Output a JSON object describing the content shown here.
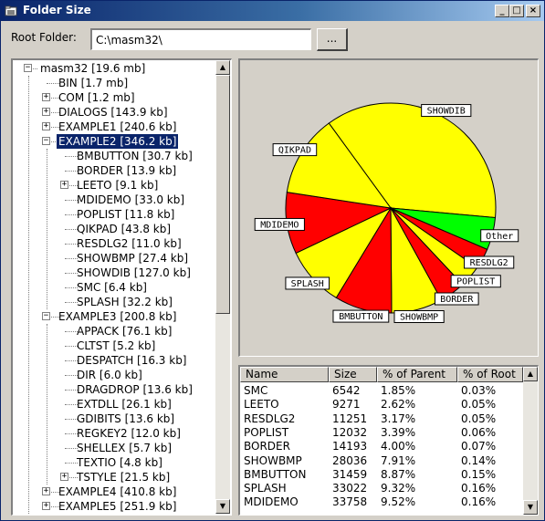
{
  "window": {
    "title": "Folder Size",
    "icon": "folder-icon"
  },
  "title_buttons": {
    "minimize": "_",
    "maximize": "□",
    "close": "×"
  },
  "root": {
    "label": "Root Folder:",
    "value": "C:\\masm32\\",
    "browse_label": "..."
  },
  "tree": {
    "items": [
      {
        "label": "masm32 [19.6 mb]",
        "level": 0,
        "expander": "−",
        "selected": false
      },
      {
        "label": "BIN [1.7 mb]",
        "level": 1,
        "expander": "",
        "selected": false
      },
      {
        "label": "COM [1.2 mb]",
        "level": 1,
        "expander": "+",
        "selected": false
      },
      {
        "label": "DIALOGS [143.9 kb]",
        "level": 1,
        "expander": "+",
        "selected": false
      },
      {
        "label": "EXAMPLE1 [240.6 kb]",
        "level": 1,
        "expander": "+",
        "selected": false
      },
      {
        "label": "EXAMPLE2 [346.2 kb]",
        "level": 1,
        "expander": "−",
        "selected": true
      },
      {
        "label": "BMBUTTON [30.7 kb]",
        "level": 2,
        "expander": "",
        "selected": false
      },
      {
        "label": "BORDER [13.9 kb]",
        "level": 2,
        "expander": "",
        "selected": false
      },
      {
        "label": "LEETO [9.1 kb]",
        "level": 2,
        "expander": "+",
        "selected": false
      },
      {
        "label": "MDIDEMO [33.0 kb]",
        "level": 2,
        "expander": "",
        "selected": false
      },
      {
        "label": "POPLIST [11.8 kb]",
        "level": 2,
        "expander": "",
        "selected": false
      },
      {
        "label": "QIKPAD [43.8 kb]",
        "level": 2,
        "expander": "",
        "selected": false
      },
      {
        "label": "RESDLG2 [11.0 kb]",
        "level": 2,
        "expander": "",
        "selected": false
      },
      {
        "label": "SHOWBMP [27.4 kb]",
        "level": 2,
        "expander": "",
        "selected": false
      },
      {
        "label": "SHOWDIB [127.0 kb]",
        "level": 2,
        "expander": "",
        "selected": false
      },
      {
        "label": "SMC [6.4 kb]",
        "level": 2,
        "expander": "",
        "selected": false
      },
      {
        "label": "SPLASH [32.2 kb]",
        "level": 2,
        "expander": "",
        "selected": false
      },
      {
        "label": "EXAMPLE3 [200.8 kb]",
        "level": 1,
        "expander": "−",
        "selected": false
      },
      {
        "label": "APPACK [76.1 kb]",
        "level": 2,
        "expander": "",
        "selected": false
      },
      {
        "label": "CLTST [5.2 kb]",
        "level": 2,
        "expander": "",
        "selected": false
      },
      {
        "label": "DESPATCH [16.3 kb]",
        "level": 2,
        "expander": "",
        "selected": false
      },
      {
        "label": "DIR [6.0 kb]",
        "level": 2,
        "expander": "",
        "selected": false
      },
      {
        "label": "DRAGDROP [13.6 kb]",
        "level": 2,
        "expander": "",
        "selected": false
      },
      {
        "label": "EXTDLL [26.1 kb]",
        "level": 2,
        "expander": "",
        "selected": false
      },
      {
        "label": "GDIBITS [13.6 kb]",
        "level": 2,
        "expander": "",
        "selected": false
      },
      {
        "label": "REGKEY2 [12.0 kb]",
        "level": 2,
        "expander": "",
        "selected": false
      },
      {
        "label": "SHELLEX [5.7 kb]",
        "level": 2,
        "expander": "",
        "selected": false
      },
      {
        "label": "TEXTIO [4.8 kb]",
        "level": 2,
        "expander": "",
        "selected": false
      },
      {
        "label": "TSTYLE [21.5 kb]",
        "level": 2,
        "expander": "+",
        "selected": false
      },
      {
        "label": "EXAMPLE4 [410.8 kb]",
        "level": 1,
        "expander": "+",
        "selected": false
      },
      {
        "label": "EXAMPLE5 [251.9 kb]",
        "level": 1,
        "expander": "+",
        "selected": false
      }
    ]
  },
  "pie": {
    "colors": {
      "yellow": "#ffff00",
      "red": "#ff0000",
      "green": "#00ff00"
    },
    "slices": [
      {
        "label": "SHOWDIB",
        "value": 127.0,
        "color": "#ffff00"
      },
      {
        "label": "Other",
        "value": 17.4,
        "color": "#00ff00"
      },
      {
        "label": "RESDLG2",
        "value": 11.0,
        "color": "#ff0000"
      },
      {
        "label": "POPLIST",
        "value": 11.8,
        "color": "#ffff00"
      },
      {
        "label": "BORDER",
        "value": 13.9,
        "color": "#ff0000"
      },
      {
        "label": "SHOWBMP",
        "value": 27.4,
        "color": "#ffff00"
      },
      {
        "label": "BMBUTTON",
        "value": 30.7,
        "color": "#ff0000"
      },
      {
        "label": "SPLASH",
        "value": 32.2,
        "color": "#ffff00"
      },
      {
        "label": "MDIDEMO",
        "value": 33.0,
        "color": "#ff0000"
      },
      {
        "label": "QIKPAD",
        "value": 43.8,
        "color": "#ffff00"
      }
    ]
  },
  "list": {
    "columns": [
      "Name",
      "Size",
      "% of Parent",
      "% of Root"
    ],
    "rows": [
      [
        "SMC",
        "6542",
        "1.85%",
        "0.03%"
      ],
      [
        "LEETO",
        "9271",
        "2.62%",
        "0.05%"
      ],
      [
        "RESDLG2",
        "11251",
        "3.17%",
        "0.05%"
      ],
      [
        "POPLIST",
        "12032",
        "3.39%",
        "0.06%"
      ],
      [
        "BORDER",
        "14193",
        "4.00%",
        "0.07%"
      ],
      [
        "SHOWBMP",
        "28036",
        "7.91%",
        "0.14%"
      ],
      [
        "BMBUTTON",
        "31459",
        "8.87%",
        "0.15%"
      ],
      [
        "SPLASH",
        "33022",
        "9.32%",
        "0.16%"
      ],
      [
        "MDIDEMO",
        "33758",
        "9.52%",
        "0.16%"
      ]
    ]
  },
  "scroll_arrows": {
    "up": "▲",
    "down": "▼"
  }
}
